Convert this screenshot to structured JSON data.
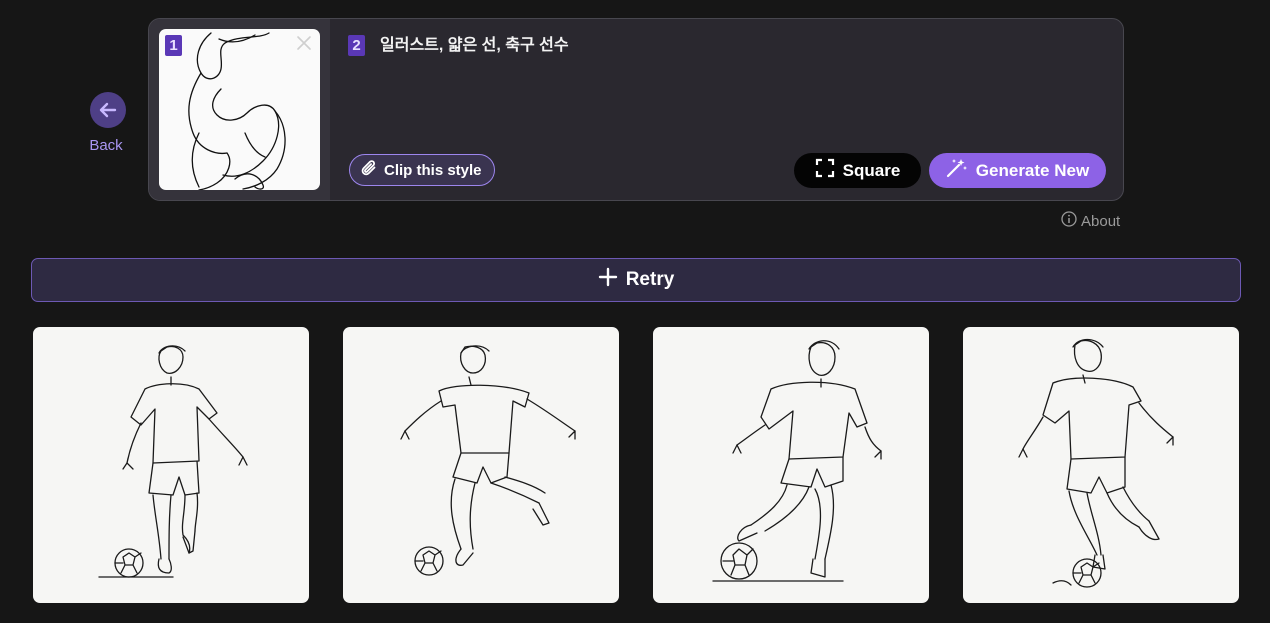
{
  "back": {
    "label": "Back",
    "icon": "arrow-left-icon"
  },
  "reference": {
    "step": "1",
    "remove_icon": "close-icon"
  },
  "prompt": {
    "step": "2",
    "text": "일러스트, 얇은 선, 축구 선수"
  },
  "actions": {
    "clip_label": "Clip this style",
    "square_label": "Square",
    "generate_label": "Generate New"
  },
  "about_label": "About",
  "retry_label": "Retry",
  "colors": {
    "accent": "#8d62e6",
    "badge": "#5a38b6",
    "background": "#161616"
  },
  "results": [
    {
      "icon": "soccer-player-sketch-image"
    },
    {
      "icon": "soccer-player-sketch-image"
    },
    {
      "icon": "soccer-player-sketch-image"
    },
    {
      "icon": "soccer-player-sketch-image"
    }
  ]
}
